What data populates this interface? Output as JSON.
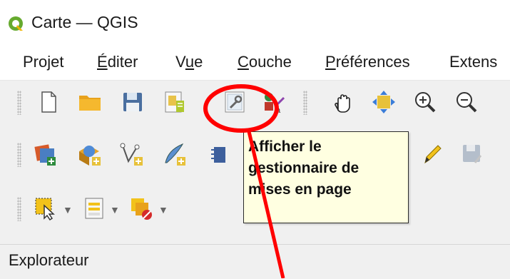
{
  "window": {
    "title": "Carte — QGIS"
  },
  "menu": [
    {
      "label": "Projet",
      "key": "j"
    },
    {
      "label": "Éditer",
      "key": "É"
    },
    {
      "label": "Vue",
      "key": "u"
    },
    {
      "label": "Couche",
      "key": "C"
    },
    {
      "label": "Préférences",
      "key": "P"
    },
    {
      "label": "Extens"
    }
  ],
  "tooltip": {
    "lines": [
      "Afficher le",
      "gestionnaire de",
      "mises en page"
    ]
  },
  "panel": {
    "title": "Explorateur"
  },
  "colors": {
    "highlight_circle": "#ff0000",
    "tooltip_bg": "#ffffe1"
  }
}
